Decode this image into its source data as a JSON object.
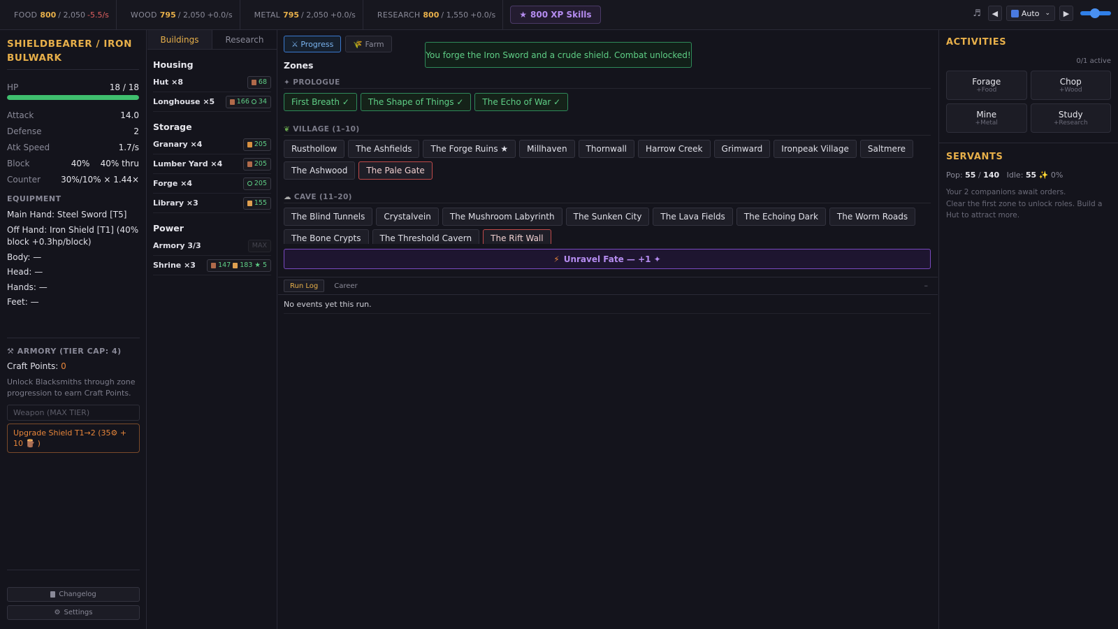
{
  "resources": [
    {
      "name": "FOOD",
      "value": "800",
      "cap": "/ 2,050",
      "rate": "-5.5/s",
      "negative": true
    },
    {
      "name": "WOOD",
      "value": "795",
      "cap": "/ 2,050",
      "rate": "+0.0/s",
      "negative": false
    },
    {
      "name": "METAL",
      "value": "795",
      "cap": "/ 2,050",
      "rate": "+0.0/s",
      "negative": false
    },
    {
      "name": "RESEARCH",
      "value": "800",
      "cap": "/ 1,550",
      "rate": "+0.0/s",
      "negative": false
    }
  ],
  "xp_button": {
    "icon": "star-icon",
    "label": "800  XP Skills"
  },
  "controls": {
    "music": "♬",
    "prev": "◀",
    "auto": "Auto",
    "play": "▶",
    "speed_fraction": 0.45
  },
  "character": {
    "title": "SHIELDBEARER / IRON BULWARK",
    "hp_label": "HP",
    "hp_value": "18 / 18",
    "hp_fraction": 1.0,
    "stats": [
      {
        "label": "Attack",
        "value": "14.0"
      },
      {
        "label": "Defense",
        "value": "2"
      },
      {
        "label": "Atk Speed",
        "value": "1.7/s"
      }
    ],
    "block": {
      "label": "Block",
      "value1": "40%",
      "value2": "40% thru"
    },
    "counter": {
      "label": "Counter",
      "value": "30%/10% × 1.44×"
    }
  },
  "equipment": {
    "title": "EQUIPMENT",
    "lines": [
      "Main Hand: Steel Sword [T5]",
      "Off Hand: Iron Shield [T1] (40% block +0.3hp/block)",
      "Body: —",
      "Head: —",
      "Hands: —",
      "Feet: —"
    ]
  },
  "armory": {
    "title": "⚒ ARMORY (TIER CAP: 4)",
    "craft_label": "Craft Points: ",
    "craft_value": "0",
    "note": "Unlock Blacksmiths through zone progression to earn Craft Points.",
    "weapon_button": "Weapon (MAX TIER)",
    "shield_button": "Upgrade Shield T1→2 (35⚙ + 10 🪵 )"
  },
  "left_bottom": {
    "changelog": "Changelog",
    "settings": "Settings"
  },
  "buildings_tabs": {
    "buildings": "Buildings",
    "research": "Research"
  },
  "building_groups": [
    {
      "title": "Housing",
      "items": [
        {
          "name": "Hut ×8",
          "cost": [
            {
              "icon": "wood",
              "amount": "68"
            }
          ]
        },
        {
          "name": "Longhouse ×5",
          "cost": [
            {
              "icon": "wood",
              "amount": "166"
            },
            {
              "icon": "metal",
              "amount": "34"
            }
          ]
        }
      ]
    },
    {
      "title": "Storage",
      "items": [
        {
          "name": "Granary ×4",
          "cost": [
            {
              "icon": "food",
              "amount": "205"
            }
          ]
        },
        {
          "name": "Lumber Yard ×4",
          "cost": [
            {
              "icon": "wood",
              "amount": "205"
            }
          ]
        },
        {
          "name": "Forge ×4",
          "cost": [
            {
              "icon": "metal",
              "amount": "205"
            }
          ]
        },
        {
          "name": "Library ×3",
          "cost": [
            {
              "icon": "research",
              "amount": "155"
            }
          ]
        }
      ]
    },
    {
      "title": "Power",
      "items": [
        {
          "name": "Armory 3/3",
          "cost": [
            {
              "icon": "",
              "amount": "MAX"
            }
          ],
          "max": true
        },
        {
          "name": "Shrine ×3",
          "cost": [
            {
              "icon": "wood",
              "amount": "147"
            },
            {
              "icon": "research",
              "amount": "183 ★ 5"
            }
          ]
        }
      ]
    }
  ],
  "center_tabs": {
    "progress": "⚔ Progress",
    "farm": "🌾 Farm"
  },
  "toast": "You forge the Iron Sword and a crude shield. Combat unlocked!",
  "zones": {
    "title": "Zones",
    "prologue": {
      "title": "✦ PROLOGUE",
      "items": [
        "First Breath ✓",
        "The Shape of Things ✓",
        "The Echo of War ✓"
      ]
    },
    "village": {
      "title": "VILLAGE (1–10)",
      "items": [
        "Rusthollow",
        "The Ashfields",
        "The Forge Ruins ★",
        "Millhaven",
        "Thornwall",
        "Harrow Creek",
        "Grimward",
        "Ironpeak Village",
        "Saltmere",
        "The Ashwood",
        "The Pale Gate"
      ]
    },
    "cave": {
      "title": "CAVE (11–20)",
      "items": [
        "The Blind Tunnels",
        "Crystalvein",
        "The Mushroom Labyrinth",
        "The Sunken City",
        "The Lava Fields",
        "The Echoing Dark",
        "The Worm Roads",
        "The Bone Crypts",
        "The Threshold Cavern",
        "The Rift Wall"
      ]
    }
  },
  "unravel": {
    "label": "Unravel Fate — +1 ✦"
  },
  "log": {
    "tab_run": "Run Log",
    "tab_career": "Career",
    "collapse": "–",
    "empty": "No events yet this run."
  },
  "activities": {
    "title": "ACTIVITIES",
    "count": "0/1 active",
    "items": [
      {
        "name": "Forage",
        "yield": "+Food"
      },
      {
        "name": "Chop",
        "yield": "+Wood"
      },
      {
        "name": "Mine",
        "yield": "+Metal"
      },
      {
        "name": "Study",
        "yield": "+Research"
      }
    ]
  },
  "servants": {
    "title": "SERVANTS",
    "pop_label": "Pop: ",
    "pop_value": "55",
    "pop_cap": "140",
    "idle_label": "Idle: ",
    "idle_value": "55",
    "rate": "0%",
    "note1": "Your 2 companions await orders.",
    "note2": "Clear the first zone to unlock roles. Build a Hut to attract more."
  }
}
